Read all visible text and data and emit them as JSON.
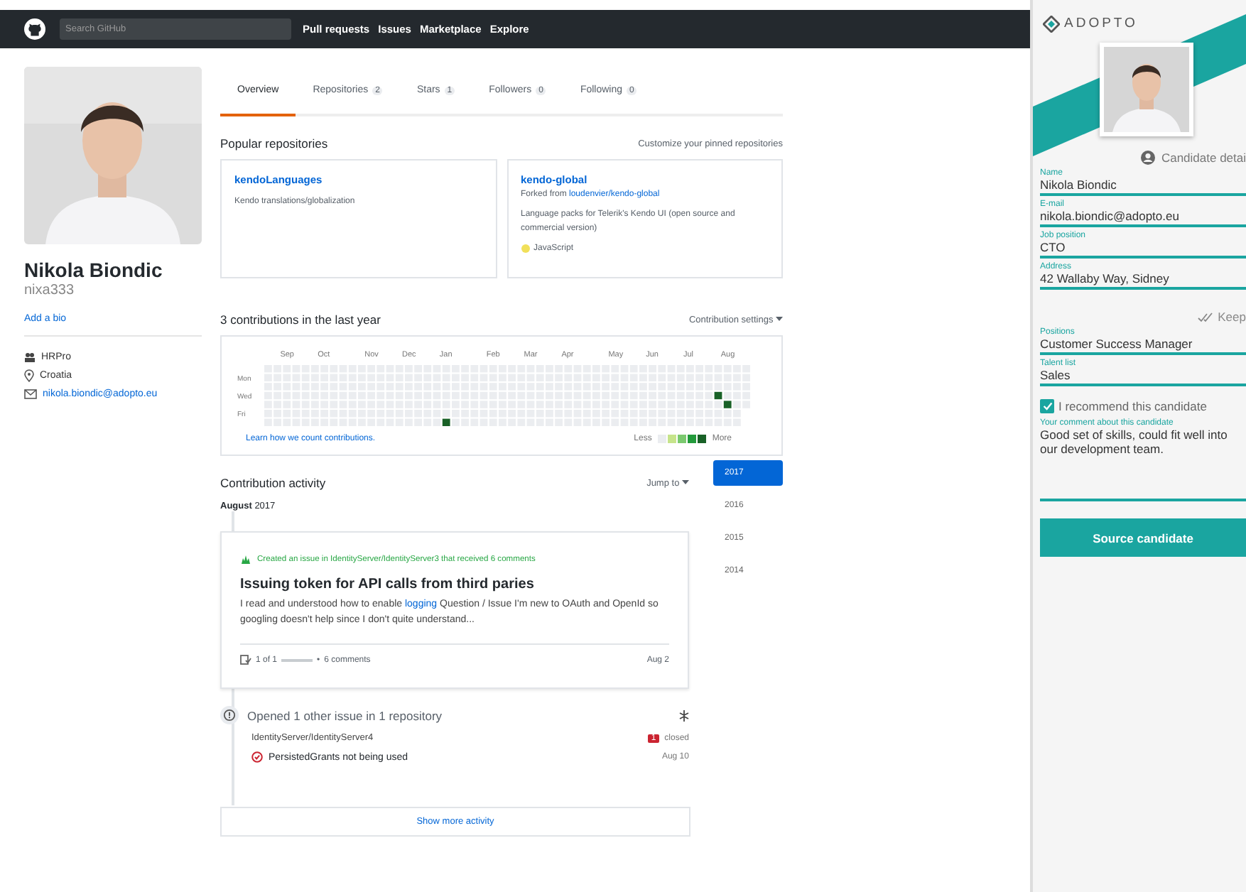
{
  "header": {
    "search_placeholder": "Search GitHub",
    "nav": [
      "Pull requests",
      "Issues",
      "Marketplace",
      "Explore"
    ]
  },
  "profile": {
    "name": "Nikola Biondic",
    "username": "nixa333",
    "bio_link": "Add a bio",
    "details": [
      {
        "kind": "organization",
        "text": "HRPro"
      },
      {
        "kind": "location",
        "text": "Croatia"
      },
      {
        "kind": "email",
        "text": "nikola.biondic@adopto.eu"
      }
    ]
  },
  "tabs": [
    {
      "label": "Overview",
      "selected": true
    },
    {
      "label": "Repositories",
      "count": "2",
      "selected": false
    },
    {
      "label": "Stars",
      "count": "1",
      "selected": false
    },
    {
      "label": "Followers",
      "count": "0",
      "selected": false
    },
    {
      "label": "Following",
      "count": "0",
      "selected": false
    }
  ],
  "popular": {
    "title": "Popular repositories",
    "customize_link": "Customize your pinned repositories",
    "repos": [
      {
        "name": "kendoLanguages",
        "description": "Kendo translations/globalization"
      },
      {
        "name": "kendo-global",
        "forked_prefix": "Forked from",
        "forked_from": "loudenvier/kendo-global",
        "description": "Language packs for Telerik's Kendo UI (open source and commercial version)",
        "language": "JavaScript",
        "color": "#f1e05a"
      }
    ]
  },
  "contributions": {
    "title": "3 contributions in the last year",
    "settings": "Contribution settings",
    "days": [
      "Mon",
      "Wed",
      "Fri"
    ],
    "learn_link": "Learn how we count contributions.",
    "less": "Less",
    "more": "More",
    "legend": [
      {
        "color": "#ebedf0"
      },
      {
        "color": "#c6e48b"
      },
      {
        "color": "#7bc96f"
      },
      {
        "color": "#239a3b"
      },
      {
        "color": "#196127"
      }
    ],
    "weeks": [
      {
        "days": [
          {
            "on": false
          },
          {
            "on": false
          },
          {
            "on": false
          },
          {
            "on": false
          },
          {
            "on": false
          },
          {
            "on": false
          },
          {
            "on": false
          }
        ]
      },
      {
        "days": [
          {
            "on": false
          },
          {
            "on": false
          },
          {
            "on": false
          },
          {
            "on": false
          },
          {
            "on": false
          },
          {
            "on": false
          },
          {
            "on": false
          }
        ]
      },
      {
        "month": "Sep",
        "days": [
          {
            "on": false
          },
          {
            "on": false
          },
          {
            "on": false
          },
          {
            "on": false
          },
          {
            "on": false
          },
          {
            "on": false
          },
          {
            "on": false
          }
        ]
      },
      {
        "days": [
          {
            "on": false
          },
          {
            "on": false
          },
          {
            "on": false
          },
          {
            "on": false
          },
          {
            "on": false
          },
          {
            "on": false
          },
          {
            "on": false
          }
        ]
      },
      {
        "days": [
          {
            "on": false
          },
          {
            "on": false
          },
          {
            "on": false
          },
          {
            "on": false
          },
          {
            "on": false
          },
          {
            "on": false
          },
          {
            "on": false
          }
        ]
      },
      {
        "days": [
          {
            "on": false
          },
          {
            "on": false
          },
          {
            "on": false
          },
          {
            "on": false
          },
          {
            "on": false
          },
          {
            "on": false
          },
          {
            "on": false
          }
        ]
      },
      {
        "month": "Oct",
        "days": [
          {
            "on": false
          },
          {
            "on": false
          },
          {
            "on": false
          },
          {
            "on": false
          },
          {
            "on": false
          },
          {
            "on": false
          },
          {
            "on": false
          }
        ]
      },
      {
        "days": [
          {
            "on": false
          },
          {
            "on": false
          },
          {
            "on": false
          },
          {
            "on": false
          },
          {
            "on": false
          },
          {
            "on": false
          },
          {
            "on": false
          }
        ]
      },
      {
        "days": [
          {
            "on": false
          },
          {
            "on": false
          },
          {
            "on": false
          },
          {
            "on": false
          },
          {
            "on": false
          },
          {
            "on": false
          },
          {
            "on": false
          }
        ]
      },
      {
        "days": [
          {
            "on": false
          },
          {
            "on": false
          },
          {
            "on": false
          },
          {
            "on": false
          },
          {
            "on": false
          },
          {
            "on": false
          },
          {
            "on": false
          }
        ]
      },
      {
        "days": [
          {
            "on": false
          },
          {
            "on": false
          },
          {
            "on": false
          },
          {
            "on": false
          },
          {
            "on": false
          },
          {
            "on": false
          },
          {
            "on": false
          }
        ]
      },
      {
        "month": "Nov",
        "days": [
          {
            "on": false
          },
          {
            "on": false
          },
          {
            "on": false
          },
          {
            "on": false
          },
          {
            "on": false
          },
          {
            "on": false
          },
          {
            "on": false
          }
        ]
      },
      {
        "days": [
          {
            "on": false
          },
          {
            "on": false
          },
          {
            "on": false
          },
          {
            "on": false
          },
          {
            "on": false
          },
          {
            "on": false
          },
          {
            "on": false
          }
        ]
      },
      {
        "days": [
          {
            "on": false
          },
          {
            "on": false
          },
          {
            "on": false
          },
          {
            "on": false
          },
          {
            "on": false
          },
          {
            "on": false
          },
          {
            "on": false
          }
        ]
      },
      {
        "days": [
          {
            "on": false
          },
          {
            "on": false
          },
          {
            "on": false
          },
          {
            "on": false
          },
          {
            "on": false
          },
          {
            "on": false
          },
          {
            "on": false
          }
        ]
      },
      {
        "month": "Dec",
        "days": [
          {
            "on": false
          },
          {
            "on": false
          },
          {
            "on": false
          },
          {
            "on": false
          },
          {
            "on": false
          },
          {
            "on": false
          },
          {
            "on": false
          }
        ]
      },
      {
        "days": [
          {
            "on": false
          },
          {
            "on": false
          },
          {
            "on": false
          },
          {
            "on": false
          },
          {
            "on": false
          },
          {
            "on": false
          },
          {
            "on": false
          }
        ]
      },
      {
        "days": [
          {
            "on": false
          },
          {
            "on": false
          },
          {
            "on": false
          },
          {
            "on": false
          },
          {
            "on": false
          },
          {
            "on": false
          },
          {
            "on": false
          }
        ]
      },
      {
        "days": [
          {
            "on": false
          },
          {
            "on": false
          },
          {
            "on": false
          },
          {
            "on": false
          },
          {
            "on": false
          },
          {
            "on": false
          },
          {
            "on": false
          }
        ]
      },
      {
        "month": "Jan",
        "days": [
          {
            "on": false
          },
          {
            "on": false
          },
          {
            "on": false
          },
          {
            "on": false
          },
          {
            "on": false
          },
          {
            "on": false
          },
          {
            "on": true
          }
        ]
      },
      {
        "days": [
          {
            "on": false
          },
          {
            "on": false
          },
          {
            "on": false
          },
          {
            "on": false
          },
          {
            "on": false
          },
          {
            "on": false
          },
          {
            "on": false
          }
        ]
      },
      {
        "days": [
          {
            "on": false
          },
          {
            "on": false
          },
          {
            "on": false
          },
          {
            "on": false
          },
          {
            "on": false
          },
          {
            "on": false
          },
          {
            "on": false
          }
        ]
      },
      {
        "days": [
          {
            "on": false
          },
          {
            "on": false
          },
          {
            "on": false
          },
          {
            "on": false
          },
          {
            "on": false
          },
          {
            "on": false
          },
          {
            "on": false
          }
        ]
      },
      {
        "days": [
          {
            "on": false
          },
          {
            "on": false
          },
          {
            "on": false
          },
          {
            "on": false
          },
          {
            "on": false
          },
          {
            "on": false
          },
          {
            "on": false
          }
        ]
      },
      {
        "month": "Feb",
        "days": [
          {
            "on": false
          },
          {
            "on": false
          },
          {
            "on": false
          },
          {
            "on": false
          },
          {
            "on": false
          },
          {
            "on": false
          },
          {
            "on": false
          }
        ]
      },
      {
        "days": [
          {
            "on": false
          },
          {
            "on": false
          },
          {
            "on": false
          },
          {
            "on": false
          },
          {
            "on": false
          },
          {
            "on": false
          },
          {
            "on": false
          }
        ]
      },
      {
        "days": [
          {
            "on": false
          },
          {
            "on": false
          },
          {
            "on": false
          },
          {
            "on": false
          },
          {
            "on": false
          },
          {
            "on": false
          },
          {
            "on": false
          }
        ]
      },
      {
        "days": [
          {
            "on": false
          },
          {
            "on": false
          },
          {
            "on": false
          },
          {
            "on": false
          },
          {
            "on": false
          },
          {
            "on": false
          },
          {
            "on": false
          }
        ]
      },
      {
        "month": "Mar",
        "days": [
          {
            "on": false
          },
          {
            "on": false
          },
          {
            "on": false
          },
          {
            "on": false
          },
          {
            "on": false
          },
          {
            "on": false
          },
          {
            "on": false
          }
        ]
      },
      {
        "days": [
          {
            "on": false
          },
          {
            "on": false
          },
          {
            "on": false
          },
          {
            "on": false
          },
          {
            "on": false
          },
          {
            "on": false
          },
          {
            "on": false
          }
        ]
      },
      {
        "days": [
          {
            "on": false
          },
          {
            "on": false
          },
          {
            "on": false
          },
          {
            "on": false
          },
          {
            "on": false
          },
          {
            "on": false
          },
          {
            "on": false
          }
        ]
      },
      {
        "days": [
          {
            "on": false
          },
          {
            "on": false
          },
          {
            "on": false
          },
          {
            "on": false
          },
          {
            "on": false
          },
          {
            "on": false
          },
          {
            "on": false
          }
        ]
      },
      {
        "month": "Apr",
        "days": [
          {
            "on": false
          },
          {
            "on": false
          },
          {
            "on": false
          },
          {
            "on": false
          },
          {
            "on": false
          },
          {
            "on": false
          },
          {
            "on": false
          }
        ]
      },
      {
        "days": [
          {
            "on": false
          },
          {
            "on": false
          },
          {
            "on": false
          },
          {
            "on": false
          },
          {
            "on": false
          },
          {
            "on": false
          },
          {
            "on": false
          }
        ]
      },
      {
        "days": [
          {
            "on": false
          },
          {
            "on": false
          },
          {
            "on": false
          },
          {
            "on": false
          },
          {
            "on": false
          },
          {
            "on": false
          },
          {
            "on": false
          }
        ]
      },
      {
        "days": [
          {
            "on": false
          },
          {
            "on": false
          },
          {
            "on": false
          },
          {
            "on": false
          },
          {
            "on": false
          },
          {
            "on": false
          },
          {
            "on": false
          }
        ]
      },
      {
        "days": [
          {
            "on": false
          },
          {
            "on": false
          },
          {
            "on": false
          },
          {
            "on": false
          },
          {
            "on": false
          },
          {
            "on": false
          },
          {
            "on": false
          }
        ]
      },
      {
        "month": "May",
        "days": [
          {
            "on": false
          },
          {
            "on": false
          },
          {
            "on": false
          },
          {
            "on": false
          },
          {
            "on": false
          },
          {
            "on": false
          },
          {
            "on": false
          }
        ]
      },
      {
        "days": [
          {
            "on": false
          },
          {
            "on": false
          },
          {
            "on": false
          },
          {
            "on": false
          },
          {
            "on": false
          },
          {
            "on": false
          },
          {
            "on": false
          }
        ]
      },
      {
        "days": [
          {
            "on": false
          },
          {
            "on": false
          },
          {
            "on": false
          },
          {
            "on": false
          },
          {
            "on": false
          },
          {
            "on": false
          },
          {
            "on": false
          }
        ]
      },
      {
        "days": [
          {
            "on": false
          },
          {
            "on": false
          },
          {
            "on": false
          },
          {
            "on": false
          },
          {
            "on": false
          },
          {
            "on": false
          },
          {
            "on": false
          }
        ]
      },
      {
        "month": "Jun",
        "days": [
          {
            "on": false
          },
          {
            "on": false
          },
          {
            "on": false
          },
          {
            "on": false
          },
          {
            "on": false
          },
          {
            "on": false
          },
          {
            "on": false
          }
        ]
      },
      {
        "days": [
          {
            "on": false
          },
          {
            "on": false
          },
          {
            "on": false
          },
          {
            "on": false
          },
          {
            "on": false
          },
          {
            "on": false
          },
          {
            "on": false
          }
        ]
      },
      {
        "days": [
          {
            "on": false
          },
          {
            "on": false
          },
          {
            "on": false
          },
          {
            "on": false
          },
          {
            "on": false
          },
          {
            "on": false
          },
          {
            "on": false
          }
        ]
      },
      {
        "days": [
          {
            "on": false
          },
          {
            "on": false
          },
          {
            "on": false
          },
          {
            "on": false
          },
          {
            "on": false
          },
          {
            "on": false
          },
          {
            "on": false
          }
        ]
      },
      {
        "month": "Jul",
        "days": [
          {
            "on": false
          },
          {
            "on": false
          },
          {
            "on": false
          },
          {
            "on": false
          },
          {
            "on": false
          },
          {
            "on": false
          },
          {
            "on": false
          }
        ]
      },
      {
        "days": [
          {
            "on": false
          },
          {
            "on": false
          },
          {
            "on": false
          },
          {
            "on": false
          },
          {
            "on": false
          },
          {
            "on": false
          },
          {
            "on": false
          }
        ]
      },
      {
        "days": [
          {
            "on": false
          },
          {
            "on": false
          },
          {
            "on": false
          },
          {
            "on": false
          },
          {
            "on": false
          },
          {
            "on": false
          },
          {
            "on": false
          }
        ]
      },
      {
        "days": [
          {
            "on": false
          },
          {
            "on": false
          },
          {
            "on": false
          },
          {
            "on": true
          },
          {
            "on": false
          },
          {
            "on": false
          },
          {
            "on": false
          }
        ]
      },
      {
        "month": "Aug",
        "days": [
          {
            "on": false
          },
          {
            "on": false
          },
          {
            "on": false
          },
          {
            "on": false
          },
          {
            "on": true
          },
          {
            "on": false
          },
          {
            "on": false
          }
        ]
      },
      {
        "days": [
          {
            "on": false
          },
          {
            "on": false
          },
          {
            "on": false
          },
          {
            "on": false
          },
          {
            "on": false
          },
          {
            "on": false
          },
          {
            "on": false
          }
        ]
      },
      {
        "days": [
          {
            "on": false
          },
          {
            "on": false
          },
          {
            "on": false
          },
          {
            "on": false
          },
          {
            "on": false
          }
        ]
      }
    ]
  },
  "activity": {
    "title": "Contribution activity",
    "jump": "Jump to",
    "month": "August",
    "year": "2017",
    "years": [
      {
        "label": "2017",
        "selected": true
      },
      {
        "label": "2016",
        "selected": false
      },
      {
        "label": "2015",
        "selected": false
      },
      {
        "label": "2014",
        "selected": false
      }
    ],
    "issue_card": {
      "summary": "Created an issue in IdentityServer/IdentityServer3 that received 6 comments",
      "title": "Issuing token for API calls from third paries",
      "body_before": "I read and understood how to enable",
      "body_link": "logging",
      "body_after": "Question / Issue I'm new to OAuth and OpenId so googling doesn't help since I don't quite understand...",
      "progress": "1 of 1",
      "level": 1,
      "separator": "•",
      "comments": "6 comments",
      "date": "Aug 2"
    },
    "other": {
      "title": "Opened 1 other issue in 1 repository",
      "repo": "IdentityServer/IdentityServer4",
      "badge_count": "1",
      "badge_label": "closed",
      "issues": [
        {
          "title": "PersistedGrants not being used",
          "date": "Aug 10"
        }
      ]
    },
    "show_more": "Show more activity"
  },
  "adopto": {
    "logo": "ADOPTO",
    "section": "Candidate detai",
    "fields": [
      {
        "label": "Name",
        "value": "Nikola Biondic"
      },
      {
        "label": "E-mail",
        "value": "nikola.biondic@adopto.eu"
      },
      {
        "label": "Job position",
        "value": "CTO"
      },
      {
        "label": "Address",
        "value": "42 Wallaby Way, Sidney"
      }
    ],
    "keep": "Keep",
    "selects": [
      {
        "label": "Positions",
        "value": "Customer Success Manager"
      },
      {
        "label": "Talent list",
        "value": "Sales"
      }
    ],
    "recommend": {
      "label": "I recommend this candidate",
      "checked": true
    },
    "comment": {
      "label": "Your comment about this candidate",
      "value": "Good set of skills, could fit well into our development team."
    },
    "button": "Source candidate"
  }
}
